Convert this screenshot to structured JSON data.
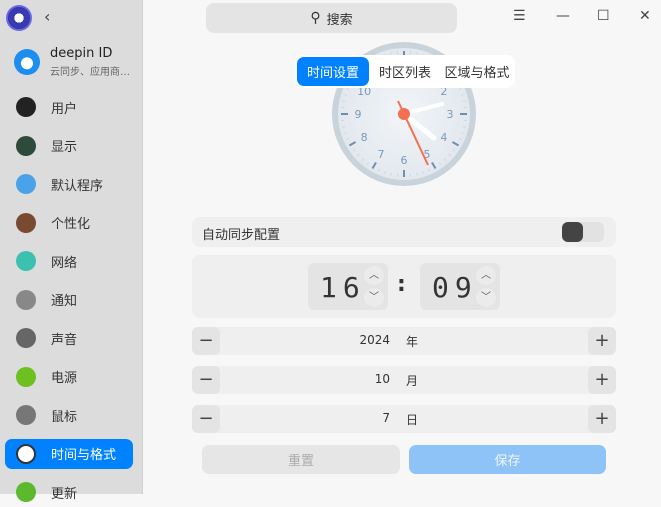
{
  "sidebar": {
    "deepin_id": {
      "title": "deepin ID",
      "subtitle": "云同步、应用商…"
    },
    "items": [
      {
        "label": "用户",
        "color": "#222"
      },
      {
        "label": "显示",
        "color": "#2d4a3a"
      },
      {
        "label": "默认程序",
        "color": "#4aa3e8"
      },
      {
        "label": "个性化",
        "color": "#7a4a30"
      },
      {
        "label": "网络",
        "color": "#3cc0b0"
      },
      {
        "label": "通知",
        "color": "#888"
      },
      {
        "label": "声音",
        "color": "#666"
      },
      {
        "label": "电源",
        "color": "#6cc020"
      },
      {
        "label": "鼠标",
        "color": "#777"
      },
      {
        "label": "时间与格式",
        "color": "#fff"
      },
      {
        "label": "更新",
        "color": "#5cb82c"
      }
    ],
    "back_icon": "‹"
  },
  "header": {
    "search_placeholder": "搜索",
    "menu": "☰",
    "minimize": "—",
    "maximize": "☐",
    "close": "✕"
  },
  "tabs": [
    "时间设置",
    "时区列表",
    "区域与格式"
  ],
  "auto_sync": {
    "label": "自动同步配置",
    "enabled": false
  },
  "time": {
    "hour": "16",
    "minute": "09",
    "sep": ":"
  },
  "date": [
    {
      "value": "2024",
      "unit": "年"
    },
    {
      "value": "10",
      "unit": "月"
    },
    {
      "value": "7",
      "unit": "日"
    }
  ],
  "buttons": {
    "reset": "重置",
    "save": "保存"
  },
  "clock_numbers": [
    "2",
    "3",
    "4",
    "5",
    "6",
    "7",
    "8",
    "9",
    "10"
  ]
}
